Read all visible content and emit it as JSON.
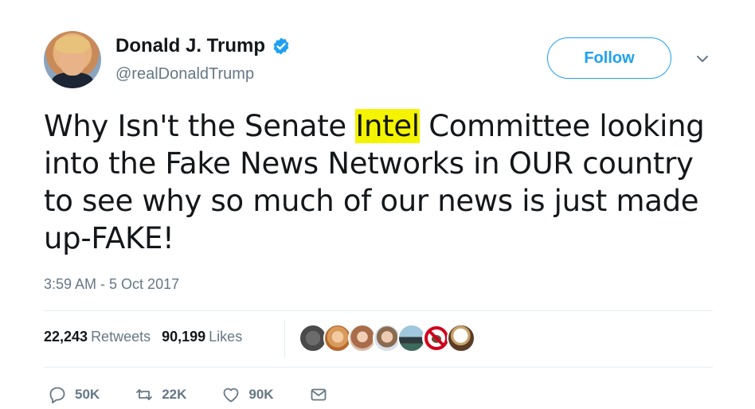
{
  "author": {
    "display_name": "Donald J. Trump",
    "handle": "@realDonaldTrump",
    "verified_icon": "verified-badge-icon"
  },
  "follow_button": {
    "label": "Follow"
  },
  "tweet": {
    "text_before": "Why Isn't the Senate ",
    "highlighted": "Intel",
    "text_after": " Committee looking into the Fake News Networks in OUR country to see why so much of our news is just made up-FAKE!",
    "timestamp": "3:59 AM - 5 Oct 2017"
  },
  "stats": {
    "retweets_count": "22,243",
    "retweets_label": "Retweets",
    "likes_count": "90,199",
    "likes_label": "Likes"
  },
  "liker_avatars": [
    "avatar-1",
    "avatar-2",
    "avatar-3",
    "avatar-4",
    "avatar-5",
    "avatar-6",
    "avatar-7"
  ],
  "actions": {
    "reply_count": "50K",
    "retweet_count": "22K",
    "like_count": "90K"
  },
  "colors": {
    "accent": "#1da1f2",
    "highlight": "#f4f400",
    "secondary_text": "#657786"
  }
}
